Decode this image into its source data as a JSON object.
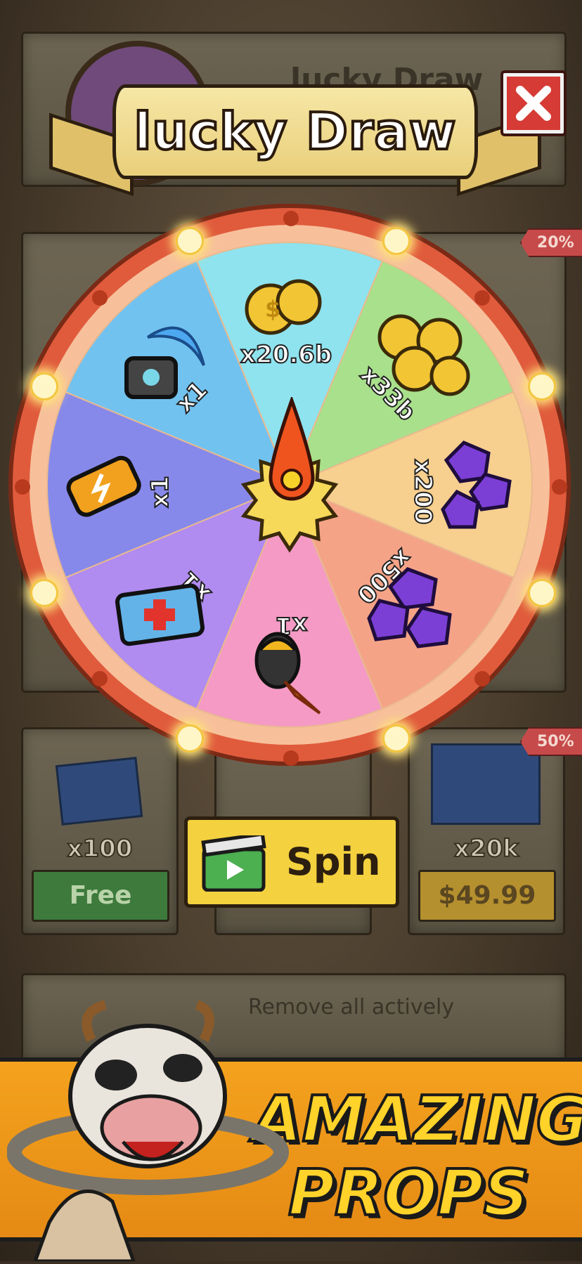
{
  "popup": {
    "title": "lucky Draw",
    "close_icon": "close-x-icon",
    "spin_label": "Spin",
    "spin_icon": "video-ad-icon"
  },
  "wheel": {
    "pointer_icon": "pointer-icon",
    "segments": [
      {
        "label": "x20.6b",
        "icon": "gold-coins-icon",
        "color": "#8ee3ef"
      },
      {
        "label": "x33b",
        "icon": "gold-coin-pile-icon",
        "color": "#a9e08b"
      },
      {
        "label": "x200",
        "icon": "purple-gems-icon",
        "color": "#f7cf8e"
      },
      {
        "label": "x500",
        "icon": "purple-gem-pile-icon",
        "color": "#f5a387"
      },
      {
        "label": "x1",
        "icon": "rocket-icon",
        "color": "#f59ac4"
      },
      {
        "label": "x1",
        "icon": "medkit-icon",
        "color": "#b08bf0"
      },
      {
        "label": "x1",
        "icon": "battery-icon",
        "color": "#8789ea"
      },
      {
        "label": "x1",
        "icon": "boomerang-device-icon",
        "color": "#72c2f0"
      }
    ]
  },
  "background_shop": {
    "header_text": "lucky Draw",
    "items": [
      {
        "count": "x100",
        "price": "Free"
      },
      {
        "count": "x20k",
        "price": "$49.99",
        "discount": "50%"
      }
    ],
    "discount_top": "20%",
    "remove_text": "Remove all actively"
  },
  "ad": {
    "line1": "AMAZING",
    "line2": "PROPS",
    "mascot": "cow-monster-mascot"
  }
}
